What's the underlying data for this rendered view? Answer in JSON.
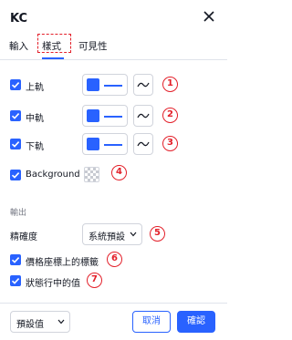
{
  "dialog": {
    "title": "KC"
  },
  "tabs": [
    {
      "label": "輸入"
    },
    {
      "label": "樣式"
    },
    {
      "label": "可見性"
    }
  ],
  "style": {
    "lines": [
      {
        "label": "上軌",
        "checked": true,
        "color": "#2962ff",
        "marker": "1"
      },
      {
        "label": "中軌",
        "checked": true,
        "color": "#2962ff",
        "marker": "2"
      },
      {
        "label": "下軌",
        "checked": true,
        "color": "#2962ff",
        "marker": "3"
      }
    ],
    "background": {
      "label": "Background",
      "checked": true,
      "marker": "4"
    }
  },
  "output": {
    "section_label": "輸出",
    "precision": {
      "label": "精確度",
      "value": "系統預設",
      "marker": "5"
    },
    "price_scale_labels": {
      "label": "價格座標上的標籤",
      "checked": true,
      "marker": "6"
    },
    "status_line_values": {
      "label": "狀態行中的值",
      "checked": true,
      "marker": "7"
    }
  },
  "footer": {
    "defaults_label": "預設值",
    "cancel_label": "取消",
    "ok_label": "確認"
  },
  "colors": {
    "accent": "#2962ff",
    "annotation": "#e3202a"
  }
}
